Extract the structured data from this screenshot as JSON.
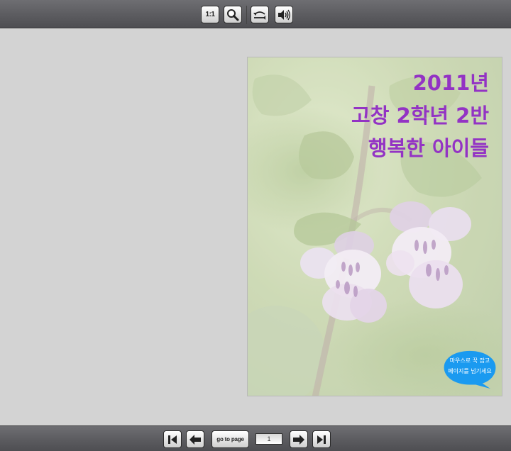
{
  "toolbar_top": {
    "ratio_label": "1:1",
    "icons": [
      "actual-size-icon",
      "zoom-icon",
      "flip-mode-icon",
      "sound-icon"
    ]
  },
  "page": {
    "title_line1": "2011년",
    "title_line2": "고창 2학년 2반",
    "title_line3": "행복한 아이들",
    "hint_line1": "마우스로 꾹 잡고",
    "hint_line2": "페이지를 넘기세요",
    "title_color": "#9333c4",
    "bubble_color": "#1a9af0"
  },
  "toolbar_bottom": {
    "goto_label": "go to page",
    "page_number": "1",
    "icons": [
      "first-page-icon",
      "previous-page-icon",
      "next-page-icon",
      "last-page-icon"
    ]
  }
}
